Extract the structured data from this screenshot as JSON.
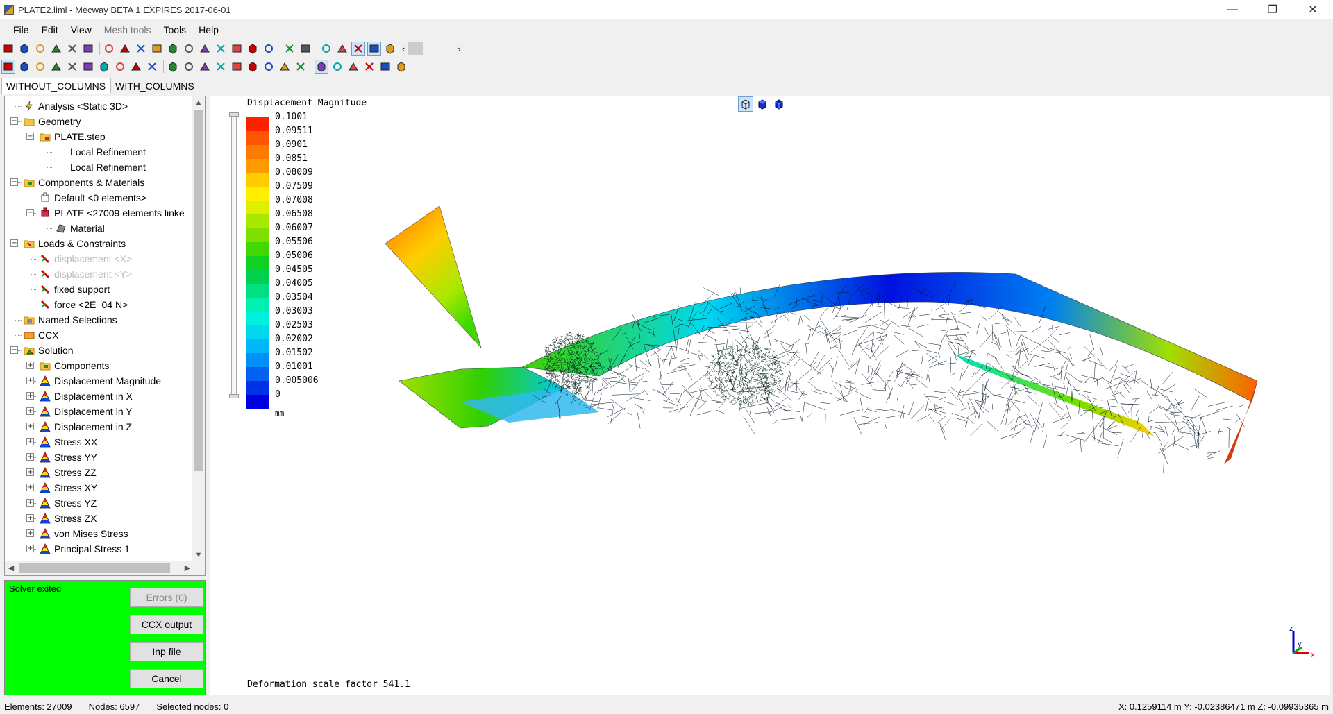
{
  "window": {
    "title": "PLATE2.liml - Mecway BETA 1 EXPIRES 2017-06-01",
    "minimize": "—",
    "restore": "❐",
    "close": "✕"
  },
  "menu": [
    {
      "label": "File",
      "disabled": false
    },
    {
      "label": "Edit",
      "disabled": false
    },
    {
      "label": "View",
      "disabled": false
    },
    {
      "label": "Mesh tools",
      "disabled": true
    },
    {
      "label": "Tools",
      "disabled": false
    },
    {
      "label": "Help",
      "disabled": false
    }
  ],
  "toolbar1": [
    "new-icon",
    "open-icon",
    "save-icon",
    "undo-icon",
    "redo-icon",
    "layers-icon",
    "sep",
    "view-iso-icon",
    "view-front-icon",
    "view-back-icon",
    "view-left-icon",
    "view-right-icon",
    "view-top-icon",
    "view-bottom-icon",
    "zoom-fit-icon",
    "zoom-icon",
    "rotate-icon",
    "query-icon",
    "sep",
    "clip-icon",
    "section-icon",
    "sep",
    "surface-icon",
    "solid-icon",
    "shaded-icon",
    "wireframe-icon",
    "mesh-icon"
  ],
  "toolbar2": [
    "select-icon",
    "select-node-icon",
    "select-paint-icon",
    "select-face-icon",
    "select-edge-icon",
    "select-box-icon",
    "box-icon",
    "sphere-icon",
    "cross-icon",
    "frame-icon",
    "sep",
    "element-icon",
    "element2-icon",
    "cylinder-icon",
    "torus-icon",
    "sweep-icon",
    "points-icon",
    "arrange-icon",
    "triangle-icon",
    "triangle2-icon",
    "sep",
    "contour-icon",
    "contour2-icon",
    "deform-icon",
    "animate-icon",
    "probe-icon",
    "table-icon"
  ],
  "toolbar_scroll": {
    "left": "‹",
    "right": "›"
  },
  "tabs": [
    {
      "label": "WITHOUT_COLUMNS",
      "active": true
    },
    {
      "label": "WITH_COLUMNS",
      "active": false
    }
  ],
  "tree": [
    {
      "label": "Analysis <Static 3D>",
      "level": 0,
      "icon": "analysis-icon",
      "expander": "",
      "muted": false
    },
    {
      "label": "Geometry",
      "level": 0,
      "icon": "folder-icon",
      "expander": "−",
      "muted": false
    },
    {
      "label": "PLATE.step",
      "level": 1,
      "icon": "step-file-icon",
      "expander": "−",
      "muted": false
    },
    {
      "label": "Local Refinement",
      "level": 2,
      "icon": "",
      "expander": "",
      "muted": false
    },
    {
      "label": "Local Refinement",
      "level": 2,
      "icon": "",
      "expander": "",
      "muted": false
    },
    {
      "label": "Components & Materials",
      "level": 0,
      "icon": "components-folder-icon",
      "expander": "−",
      "muted": false
    },
    {
      "label": "Default <0 elements>",
      "level": 1,
      "icon": "component-empty-icon",
      "expander": "",
      "muted": false
    },
    {
      "label": "PLATE <27009 elements linke",
      "level": 1,
      "icon": "component-icon",
      "expander": "−",
      "muted": false
    },
    {
      "label": "Material",
      "level": 2,
      "icon": "material-icon",
      "expander": "",
      "muted": false
    },
    {
      "label": "Loads & Constraints",
      "level": 0,
      "icon": "loads-folder-icon",
      "expander": "−",
      "muted": false
    },
    {
      "label": "displacement <X>",
      "level": 1,
      "icon": "constraint-icon",
      "expander": "",
      "muted": true
    },
    {
      "label": "displacement <Y>",
      "level": 1,
      "icon": "constraint-icon",
      "expander": "",
      "muted": true
    },
    {
      "label": "fixed support",
      "level": 1,
      "icon": "constraint-icon",
      "expander": "",
      "muted": false
    },
    {
      "label": "force <2E+04 N>",
      "level": 1,
      "icon": "constraint-icon",
      "expander": "",
      "muted": false
    },
    {
      "label": "Named Selections",
      "level": 0,
      "icon": "named-selection-icon",
      "expander": "",
      "muted": false
    },
    {
      "label": "CCX",
      "level": 0,
      "icon": "ccx-icon",
      "expander": "",
      "muted": false
    },
    {
      "label": "Solution",
      "level": 0,
      "icon": "solution-icon",
      "expander": "−",
      "muted": false
    },
    {
      "label": "Components",
      "level": 1,
      "icon": "components-folder-icon",
      "expander": "+",
      "muted": false
    },
    {
      "label": "Displacement Magnitude",
      "level": 1,
      "icon": "result-icon",
      "expander": "+",
      "muted": false
    },
    {
      "label": "Displacement in X",
      "level": 1,
      "icon": "result-icon",
      "expander": "+",
      "muted": false
    },
    {
      "label": "Displacement in Y",
      "level": 1,
      "icon": "result-icon",
      "expander": "+",
      "muted": false
    },
    {
      "label": "Displacement in Z",
      "level": 1,
      "icon": "result-icon",
      "expander": "+",
      "muted": false
    },
    {
      "label": "Stress XX",
      "level": 1,
      "icon": "result-icon",
      "expander": "+",
      "muted": false
    },
    {
      "label": "Stress YY",
      "level": 1,
      "icon": "result-icon",
      "expander": "+",
      "muted": false
    },
    {
      "label": "Stress ZZ",
      "level": 1,
      "icon": "result-icon",
      "expander": "+",
      "muted": false
    },
    {
      "label": "Stress XY",
      "level": 1,
      "icon": "result-icon",
      "expander": "+",
      "muted": false
    },
    {
      "label": "Stress YZ",
      "level": 1,
      "icon": "result-icon",
      "expander": "+",
      "muted": false
    },
    {
      "label": "Stress ZX",
      "level": 1,
      "icon": "result-icon",
      "expander": "+",
      "muted": false
    },
    {
      "label": "von Mises Stress",
      "level": 1,
      "icon": "result-icon",
      "expander": "+",
      "muted": false
    },
    {
      "label": "Principal Stress 1",
      "level": 1,
      "icon": "result-icon",
      "expander": "+",
      "muted": false
    }
  ],
  "tree_scroll": {
    "up": "▲",
    "down": "▼",
    "left": "◀",
    "right": "▶"
  },
  "solver": {
    "status": "Solver exited",
    "buttons": [
      {
        "label": "Errors (0)",
        "disabled": true,
        "name": "errors-button"
      },
      {
        "label": "CCX output",
        "disabled": false,
        "name": "ccx-output-button"
      },
      {
        "label": "Inp file",
        "disabled": false,
        "name": "inp-file-button"
      },
      {
        "label": "Cancel",
        "disabled": false,
        "name": "cancel-button"
      }
    ]
  },
  "viewport": {
    "legend_title": "Displacement Magnitude",
    "legend_values": [
      "0.1001",
      "0.09511",
      "0.0901",
      "0.0851",
      "0.08009",
      "0.07509",
      "0.07008",
      "0.06508",
      "0.06007",
      "0.05506",
      "0.05006",
      "0.04505",
      "0.04005",
      "0.03504",
      "0.03003",
      "0.02503",
      "0.02002",
      "0.01502",
      "0.01001",
      "0.005006",
      "0"
    ],
    "legend_colors": [
      "#ff2000",
      "#ff5500",
      "#ff7a00",
      "#ff9a00",
      "#ffcc00",
      "#ffee00",
      "#ddf000",
      "#aae800",
      "#7fe000",
      "#40d800",
      "#10d020",
      "#00d050",
      "#00e080",
      "#00f0b0",
      "#00f0e0",
      "#00d8f0",
      "#00b8f8",
      "#0090f8",
      "#0060f0",
      "#0030e8",
      "#0000e0"
    ],
    "legend_unit": "mm",
    "scale_factor": "Deformation scale factor 541.1",
    "triad": {
      "x": "x",
      "y": "y",
      "z": "z"
    }
  },
  "status": {
    "elements": "Elements: 27009",
    "nodes": "Nodes: 6597",
    "selected": "Selected nodes: 0",
    "coords": "X: 0.1259114 m Y: -0.02386471 m Z: -0.09935365 m"
  }
}
